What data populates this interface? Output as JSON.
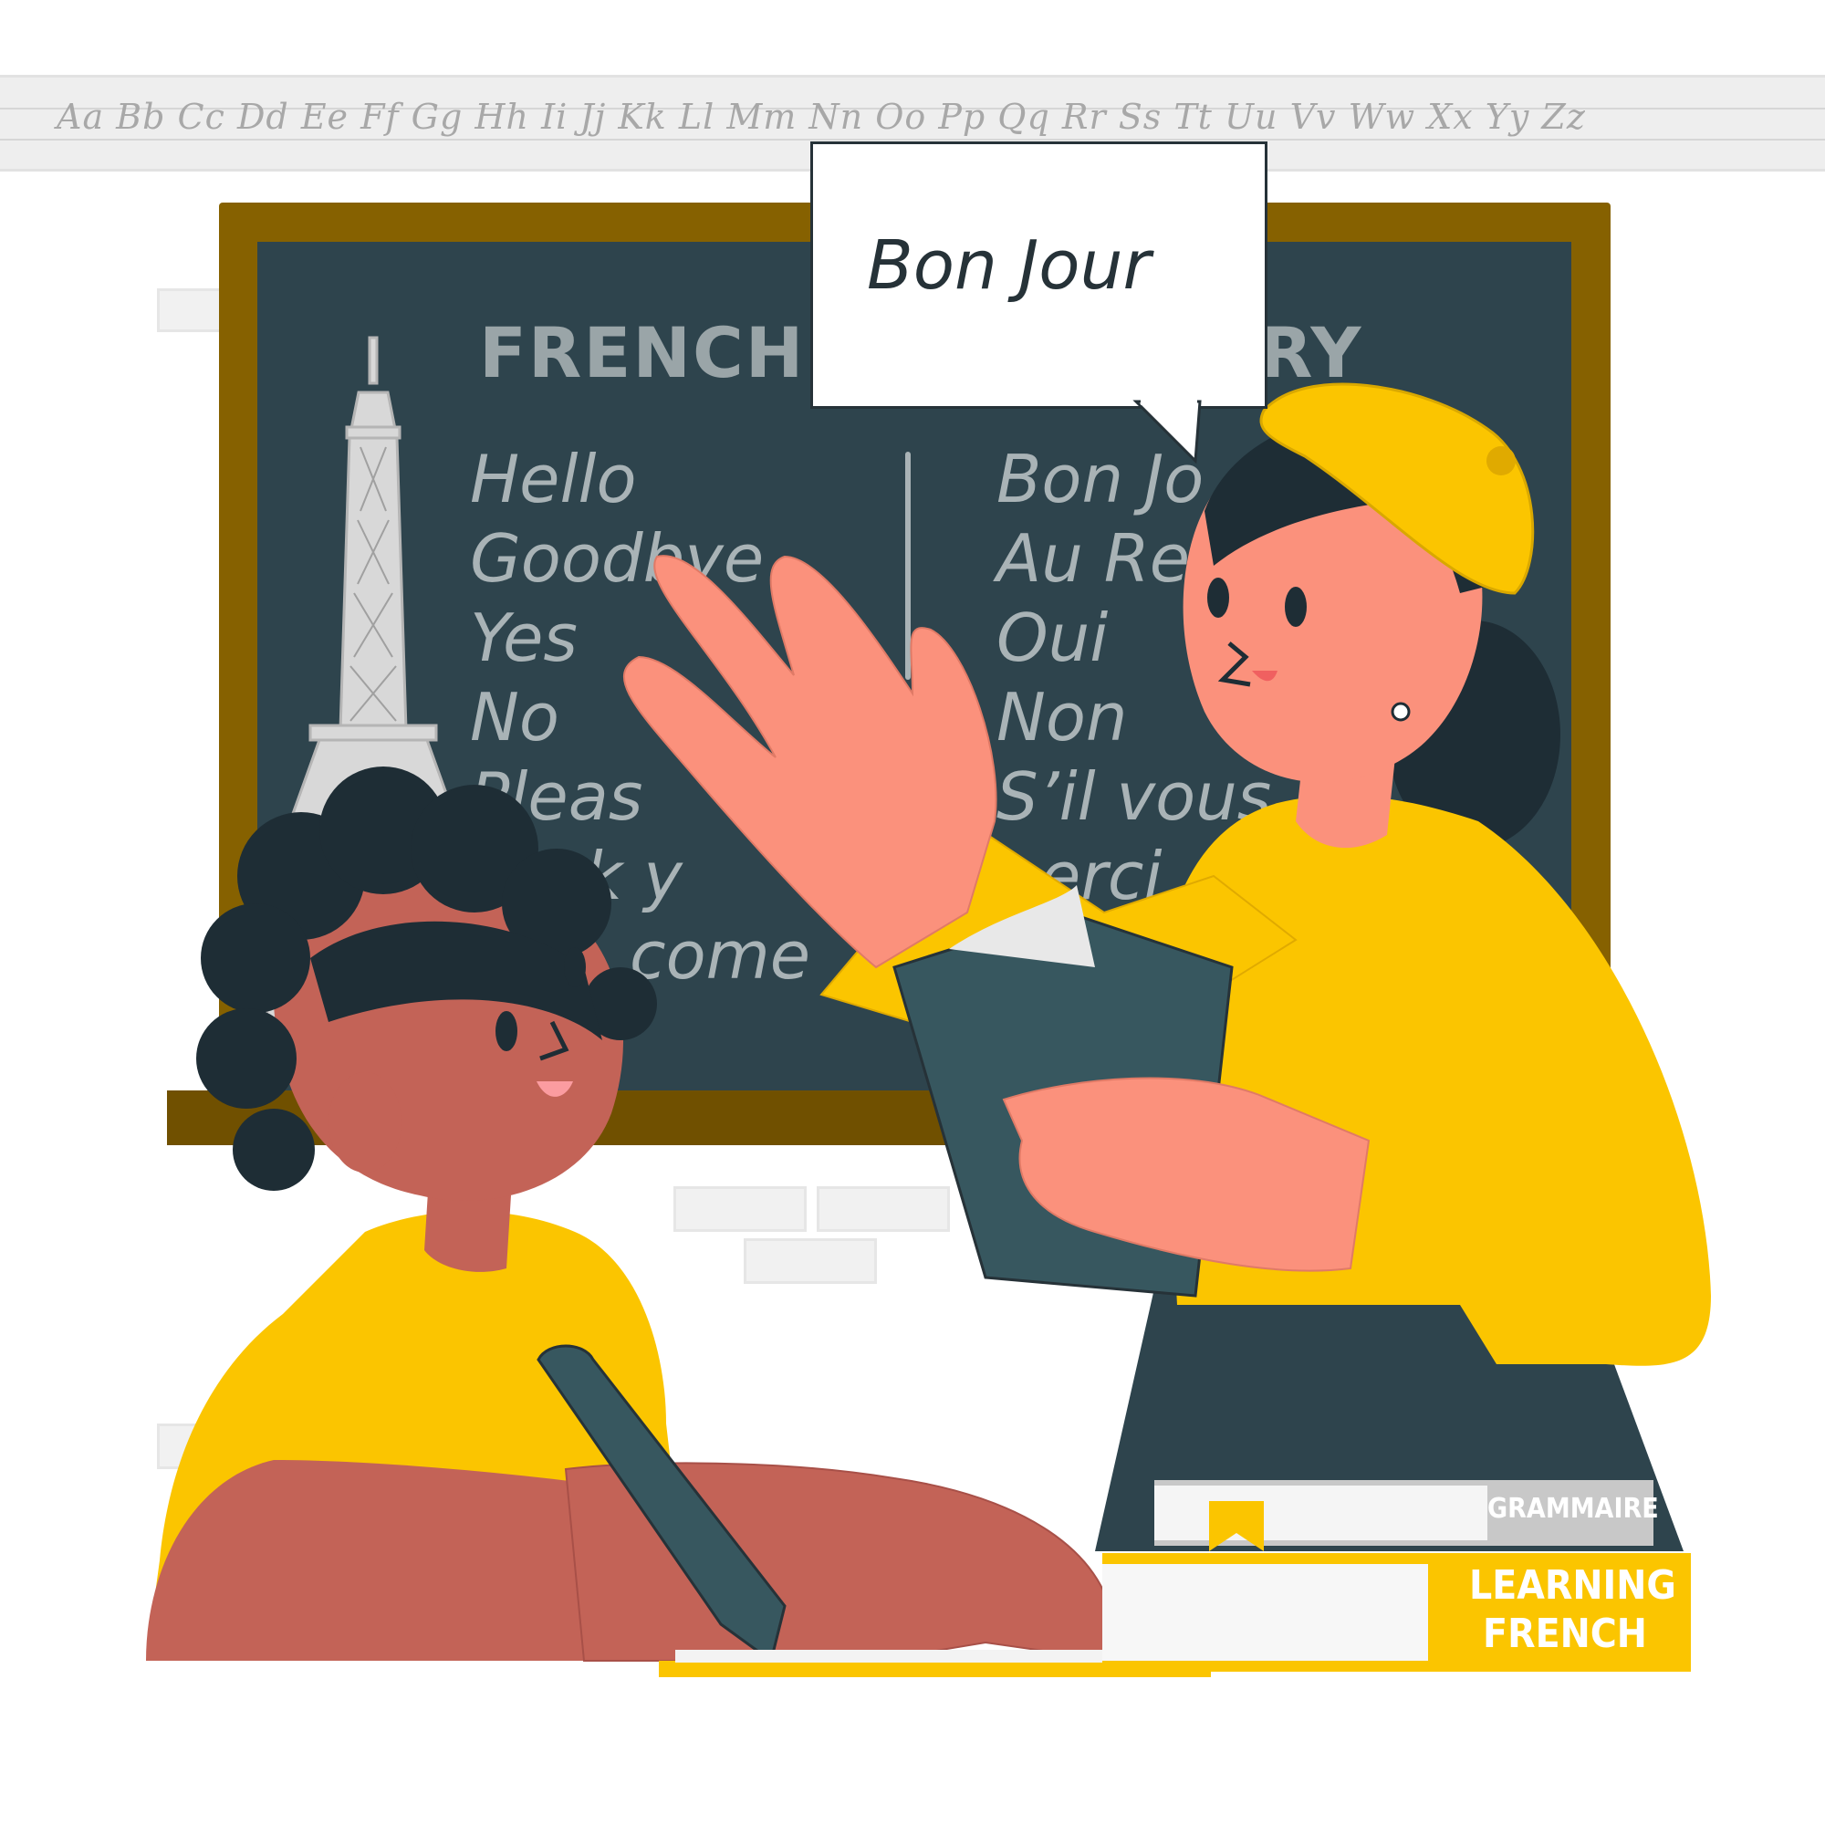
{
  "alphabet_strip": "Aa Bb Cc Dd Ee Ff Gg Hh Ii Jj Kk Ll Mm Nn Oo Pp Qq Rr Ss Tt Uu Vv Ww Xx Yy Zz",
  "board": {
    "title_left": "FRENCH",
    "title_right": "RY",
    "english": [
      "Hello",
      "Goodbye",
      "Yes",
      "No",
      "Pleas",
      "nk y",
      "come"
    ],
    "french": [
      "Bon Jo",
      "Au Re",
      "Oui",
      "Non",
      "S’il vous",
      "erci"
    ]
  },
  "speech_bubble": "Bon Jour",
  "books": {
    "top_label": "GRAMMAIRE",
    "bottom_label_line1": "LEARNING",
    "bottom_label_line2": "FRENCH"
  },
  "colors": {
    "board": "#2e444d",
    "frame": "#866100",
    "accent_yellow": "#fbc500",
    "teacher_skin": "#fb917c",
    "student_skin": "#c36357",
    "dark": "#1e2d35"
  }
}
